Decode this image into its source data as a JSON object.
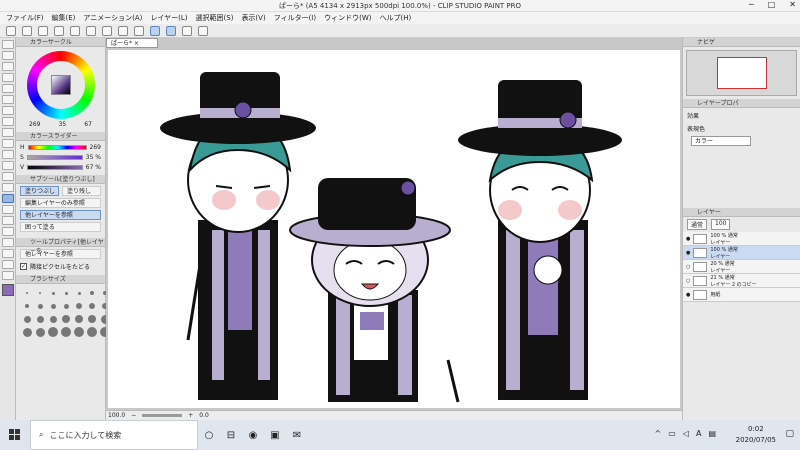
{
  "window": {
    "title": "ぱーら* (A5 4134 x 2913px 500dpi 100.0%) - CLIP STUDIO PAINT PRO"
  },
  "menu": [
    "ファイル(F)",
    "編集(E)",
    "アニメーション(A)",
    "レイヤー(L)",
    "選択範囲(S)",
    "表示(V)",
    "フィルター(I)",
    "ウィンドウ(W)",
    "ヘルプ(H)"
  ],
  "left_panel": {
    "color_wheel_title": "カラーサークル",
    "hsv": [
      "269",
      "35",
      "67"
    ],
    "color_slider_title": "カラースライダー",
    "sliders": [
      {
        "label": "H",
        "value": "269"
      },
      {
        "label": "S",
        "value": "35 %"
      },
      {
        "label": "V",
        "value": "67 %"
      }
    ],
    "subtool_title": "サブツール[塗りつぶし]",
    "subtools": [
      "塗りつぶし",
      "編集レイヤーのみ参照",
      "他レイヤーを参照",
      "囲って塗る"
    ],
    "tab_extra": "塗り残し",
    "tool_property_title": "ツールプロパティ[他レイヤーを",
    "tool_property_value": "他レイヤーを参照",
    "option_label": "隣接ピクセルをたどる",
    "brush_size_title": "ブラシサイズ"
  },
  "canvas": {
    "tab": "ぱーら*",
    "zoom": "100.0",
    "angle": "0.0"
  },
  "right_panel": {
    "navigator_title": "ナビゲ",
    "layer_prop_title": "レイヤープロパ",
    "effect_label": "効果",
    "display_color_label": "表現色",
    "display_color_value": "カラー",
    "layer_tab": "レイヤー",
    "blend_mode": "通常",
    "opacity": "100",
    "layers": [
      {
        "percent": "100 % 通常",
        "name": "レイヤー"
      },
      {
        "percent": "100 % 通常",
        "name": "レイヤー"
      },
      {
        "percent": "20 % 通常",
        "name": "レイヤー"
      },
      {
        "percent": "21 % 通常",
        "name": "レイヤー 2 のコピー"
      },
      {
        "percent": "",
        "name": "用紙"
      }
    ]
  },
  "taskbar": {
    "search_placeholder": "ここに入力して検索",
    "time": "0:02",
    "date": "2020/07/05",
    "ime": "A"
  }
}
